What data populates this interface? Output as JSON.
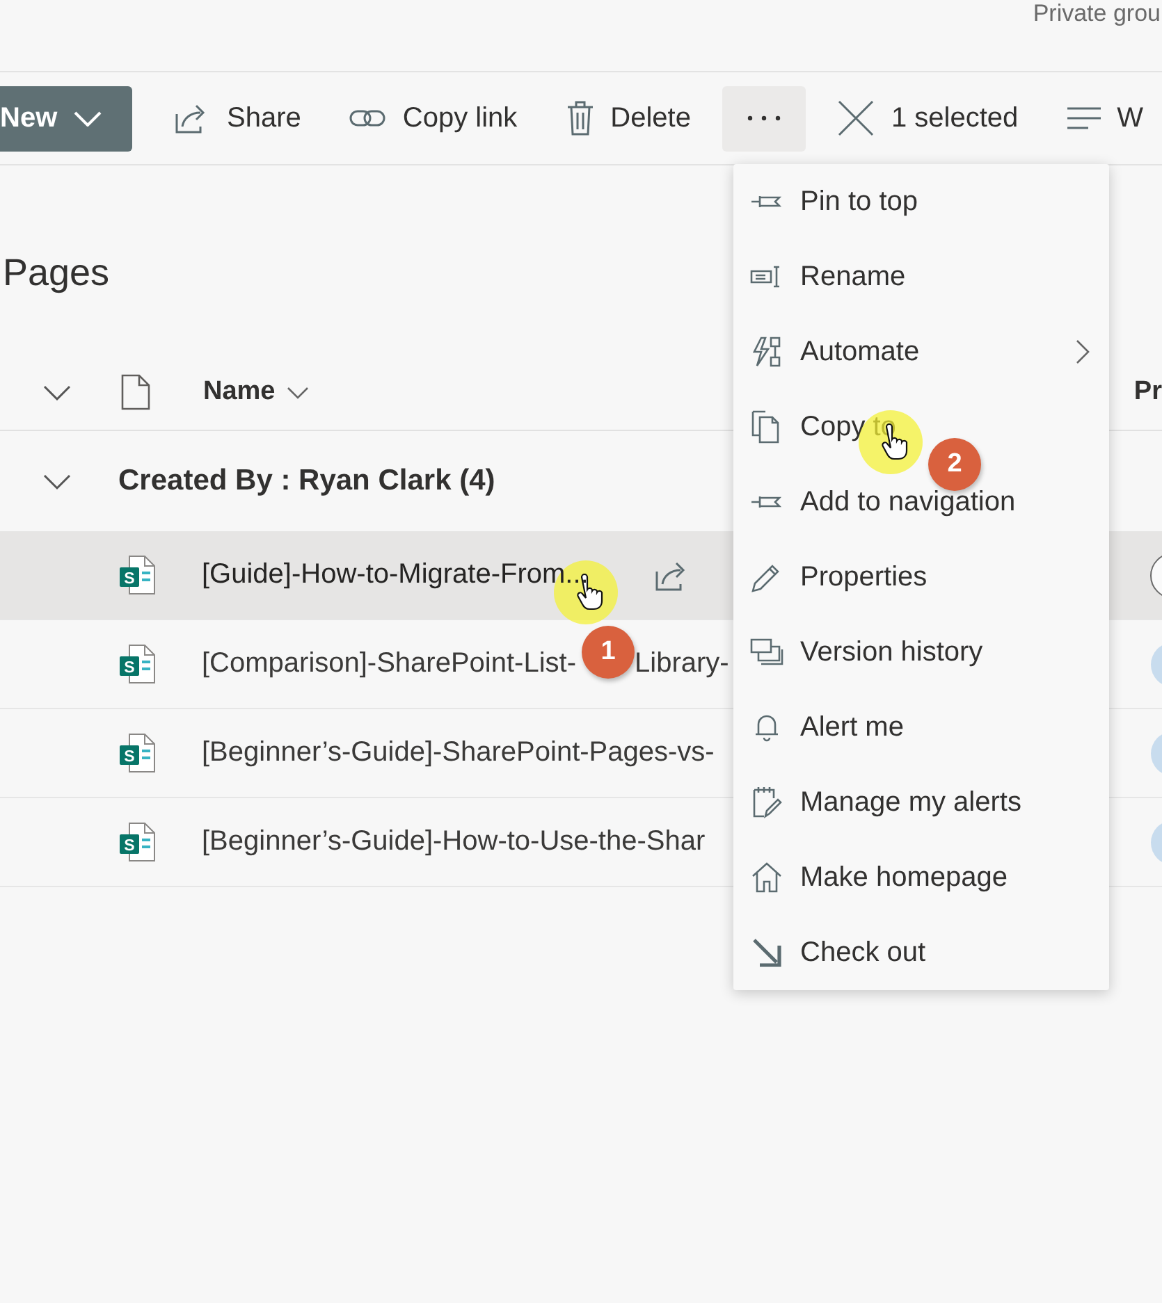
{
  "top_bar": {
    "group_type": "Private grou"
  },
  "command_bar": {
    "items": [
      {
        "kind": "new",
        "label": "New",
        "active": false
      },
      {
        "kind": "share",
        "label": "Share",
        "active": false
      },
      {
        "kind": "link",
        "label": "Copy link",
        "active": false
      },
      {
        "kind": "delete",
        "label": "Delete",
        "active": false
      },
      {
        "kind": "more",
        "active": true
      },
      {
        "kind": "clear",
        "label": "1 selected",
        "active": false
      },
      {
        "kind": "view",
        "label": "W",
        "active": false
      }
    ]
  },
  "page_title": "Pages",
  "list": {
    "columns": [
      {
        "label": "Name",
        "sortable": true
      },
      {
        "label": "Pr",
        "sortable": false
      }
    ],
    "groups": [
      {
        "label": "Created By : Ryan Clark (4)",
        "expanded": true,
        "rows": [
          {
            "name": [
              "[Guide]-How-to-Migrate-From..."
            ],
            "type_badge": "S",
            "selected": true
          },
          {
            "name": [
              "[Comparison]-SharePoint-List-",
              "Library-"
            ],
            "type_badge": "S",
            "selected": false
          },
          {
            "name": [
              "[Beginner’s-Guide]-SharePoint-Pages-vs-"
            ],
            "type_badge": "S",
            "selected": false
          },
          {
            "name": [
              "[Beginner’s-Guide]-How-to-Use-the-Shar"
            ],
            "type_badge": "S",
            "selected": false
          }
        ]
      }
    ]
  },
  "menu": {
    "items": [
      {
        "label": "Pin to top",
        "submenu": false
      },
      {
        "label": "Rename",
        "submenu": false
      },
      {
        "label": "Automate",
        "submenu": true
      },
      {
        "label": "Copy to",
        "submenu": false
      },
      {
        "label": "Add to navigation",
        "submenu": false
      },
      {
        "label": "Properties",
        "submenu": false
      },
      {
        "label": "Version history",
        "submenu": false
      },
      {
        "label": "Alert me",
        "submenu": false
      },
      {
        "label": "Manage my alerts",
        "submenu": false
      },
      {
        "label": "Make homepage",
        "submenu": false
      },
      {
        "label": "Check out",
        "submenu": false
      }
    ]
  },
  "annotations": [
    {
      "label": "1"
    },
    {
      "label": "2"
    }
  ]
}
